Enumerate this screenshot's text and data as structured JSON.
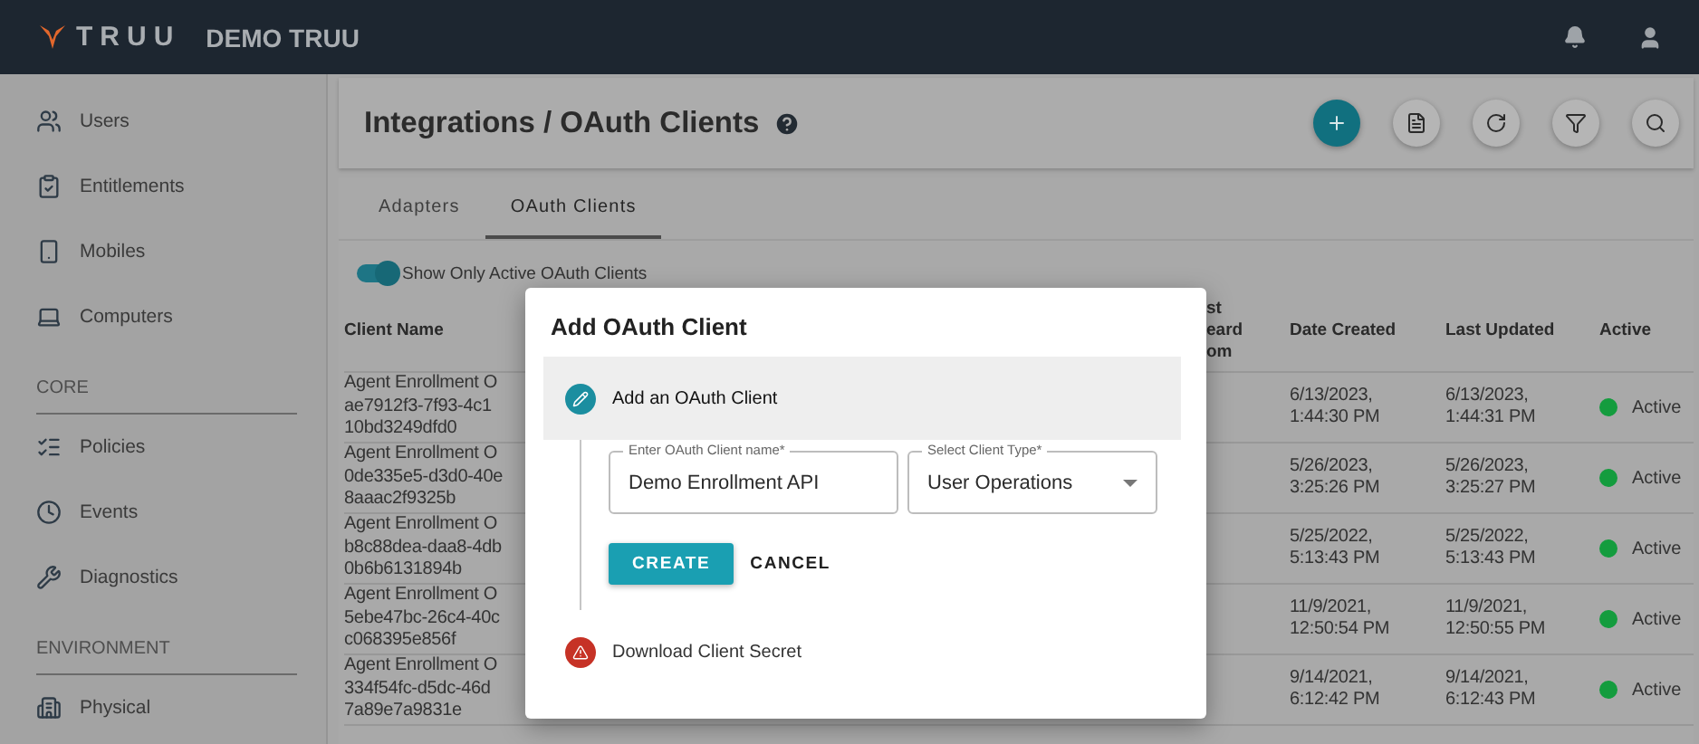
{
  "app_bar": {
    "logo": "TRUU",
    "tenant": "DEMO TRUU"
  },
  "sidebar": {
    "items": [
      {
        "kind": "item",
        "label": "Users"
      },
      {
        "kind": "item",
        "label": "Entitlements"
      },
      {
        "kind": "item",
        "label": "Mobiles"
      },
      {
        "kind": "item",
        "label": "Computers"
      },
      {
        "kind": "section",
        "label": "CORE"
      },
      {
        "kind": "item",
        "label": "Policies"
      },
      {
        "kind": "item",
        "label": "Events"
      },
      {
        "kind": "item",
        "label": "Diagnostics"
      },
      {
        "kind": "section",
        "label": "ENVIRONMENT"
      },
      {
        "kind": "item",
        "label": "Physical"
      }
    ]
  },
  "page": {
    "title": "Integrations / OAuth Clients",
    "actions": [
      {
        "primary": true
      },
      {
        "primary": false
      },
      {
        "primary": false
      },
      {
        "primary": false
      },
      {
        "primary": false
      }
    ]
  },
  "tabs": [
    {
      "label": "Adapters",
      "selected": false
    },
    {
      "label": "OAuth Clients",
      "selected": true
    }
  ],
  "toggle": {
    "label": "Show Only Active OAuth Clients",
    "checked": true
  },
  "table": {
    "columns": [
      {
        "label": [
          "Client Name"
        ]
      },
      {
        "label": [
          "st",
          "eard",
          "om"
        ]
      },
      {
        "label": [
          "Date Created"
        ]
      },
      {
        "label": [
          "Last Updated"
        ]
      },
      {
        "label": [
          "Active"
        ]
      }
    ],
    "rows": [
      {
        "client_name": [
          "Agent Enrollment O",
          "ae7912f3-7f93-4c1",
          "10bd3249dfd0"
        ],
        "date_created": [
          "6/13/2023,",
          "1:44:30 PM"
        ],
        "last_updated": [
          "6/13/2023,",
          "1:44:31 PM"
        ],
        "active": true,
        "status": "Active"
      },
      {
        "client_name": [
          "Agent Enrollment O",
          "0de335e5-d3d0-40e",
          "8aaac2f9325b"
        ],
        "date_created": [
          "5/26/2023,",
          "3:25:26 PM"
        ],
        "last_updated": [
          "5/26/2023,",
          "3:25:27 PM"
        ],
        "active": true,
        "status": "Active"
      },
      {
        "client_name": [
          "Agent Enrollment O",
          "b8c88dea-daa8-4db",
          "0b6b6131894b"
        ],
        "date_created": [
          "5/25/2022,",
          "5:13:43 PM"
        ],
        "last_updated": [
          "5/25/2022,",
          "5:13:43 PM"
        ],
        "active": true,
        "status": "Active"
      },
      {
        "client_name": [
          "Agent Enrollment O",
          "5ebe47bc-26c4-40c",
          "c068395e856f"
        ],
        "date_created": [
          "11/9/2021,",
          "12:50:54 PM"
        ],
        "last_updated": [
          "11/9/2021,",
          "12:50:55 PM"
        ],
        "active": true,
        "status": "Active"
      },
      {
        "client_name": [
          "Agent Enrollment O",
          "334f54fc-d5dc-46d",
          "7a89e7a9831e"
        ],
        "date_created": [
          "9/14/2021,",
          "6:12:42 PM"
        ],
        "last_updated": [
          "9/14/2021,",
          "6:12:43 PM"
        ],
        "active": true,
        "status": "Active"
      }
    ]
  },
  "dialog": {
    "title": "Add OAuth Client",
    "steps": [
      {
        "kind": "edit",
        "label": "Add an OAuth Client",
        "active": true
      },
      {
        "kind": "error",
        "label": "Download Client Secret",
        "active": false
      }
    ],
    "name_field": {
      "label": "Enter OAuth Client name*",
      "value": "Demo Enrollment API"
    },
    "type_select": {
      "label": "Select Client Type*",
      "value": "User Operations"
    },
    "buttons": [
      {
        "kind": "primary",
        "label": "CREATE"
      },
      {
        "kind": "text",
        "label": "CANCEL"
      }
    ]
  }
}
